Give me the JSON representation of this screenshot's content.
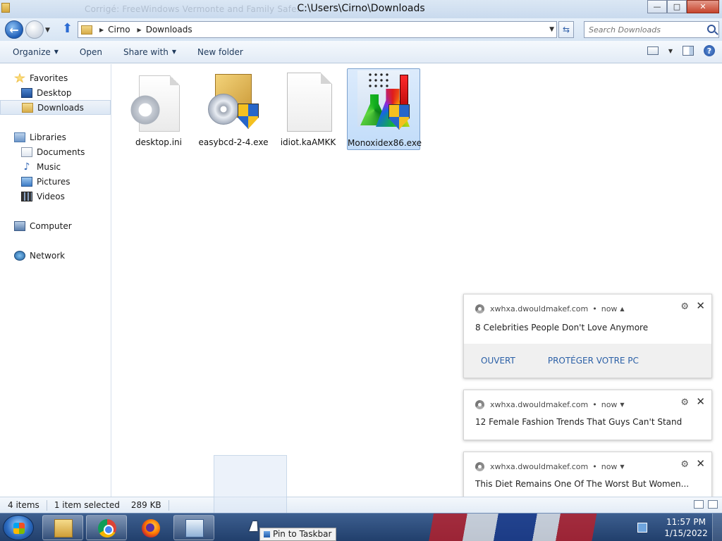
{
  "window": {
    "title": "C:\\Users\\Cirno\\Downloads",
    "ghost_text": "Corrigé: FreeWindows Vermonte and Family Safe...",
    "buttons": {
      "minimize": "—",
      "maximize": "□",
      "close": "✕"
    }
  },
  "address": {
    "crumbs": [
      "Cirno",
      "Downloads"
    ],
    "search_placeholder": "Search Downloads"
  },
  "commands": [
    "Organize",
    "Open",
    "Share with",
    "New folder"
  ],
  "help_label": "?",
  "nav": {
    "favorites_label": "Favorites",
    "favorites": [
      "Desktop",
      "Downloads"
    ],
    "libraries_label": "Libraries",
    "libraries": [
      "Documents",
      "Music",
      "Pictures",
      "Videos"
    ],
    "computer": "Computer",
    "network": "Network",
    "selected": "Downloads"
  },
  "files": [
    {
      "name": "desktop.ini",
      "icon": "settings-file-icon"
    },
    {
      "name": "easybcd-2-4.exe",
      "icon": "installer-icon"
    },
    {
      "name": "idiot.kaAMKK",
      "icon": "blank-file-icon"
    },
    {
      "name": "Monoxidex86.exe",
      "icon": "chemistry-app-icon",
      "selected": true
    }
  ],
  "status": {
    "count": "4 items",
    "selection": "1 item selected",
    "size": "289 KB"
  },
  "notifications": [
    {
      "source": "xwhxa.dwouldmakef.com",
      "time": "now",
      "message": "8 Celebrities People Don't Love Anymore",
      "actions": [
        "OUVERT",
        "PROTÉGER VOTRE PC"
      ],
      "expanded": true
    },
    {
      "source": "xwhxa.dwouldmakef.com",
      "time": "now",
      "message": "12 Female Fashion Trends That Guys Can't Stand"
    },
    {
      "source": "xwhxa.dwouldmakef.com",
      "time": "now",
      "message": "This Diet Remains One Of The Worst But Women..."
    }
  ],
  "taskbar": {
    "pin_tooltip": "Pin to Taskbar",
    "apps": [
      "explorer-icon",
      "chrome-icon",
      "firefox-icon",
      "control-panel-icon"
    ],
    "clock": {
      "time": "11:57 PM",
      "date": "1/15/2022"
    }
  }
}
